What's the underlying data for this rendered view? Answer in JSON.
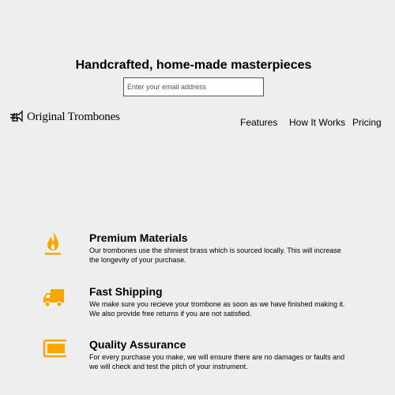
{
  "hero": {
    "title": "Handcrafted, home-made masterpieces",
    "email_placeholder": "Enter your email address"
  },
  "header": {
    "logo_text": "Original Trombones",
    "logo_icon": "trombone-icon"
  },
  "nav": {
    "items": [
      "Features",
      "How It Works",
      "Pricing"
    ]
  },
  "features": [
    {
      "icon": "fire-icon",
      "title": "Premium Materials",
      "text": "Our trombones use the shiniest brass which is sourced locally. This will increase the longevity of your purchase."
    },
    {
      "icon": "truck-icon",
      "title": "Fast Shipping",
      "text": "We make sure you recieve your trombone as soon as we have finished making it. We also provide free returns if you are not satisfied."
    },
    {
      "icon": "battery-full-icon",
      "title": "Quality Assurance",
      "text": "For every purchase you make, we will ensure there are no damages or faults and we will check and test the pitch of your instrument."
    }
  ],
  "colors": {
    "accent": "#f5a800",
    "background": "#eeeeee"
  }
}
